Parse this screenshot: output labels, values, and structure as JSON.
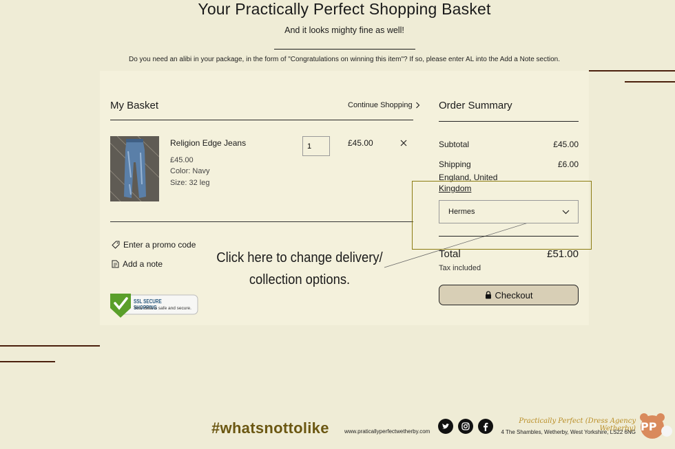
{
  "header": {
    "title": "Your Practically Perfect Shopping Basket",
    "subtitle": "And it looks mighty fine as well!",
    "note": "Do you need an alibi in your package, in the form of \"Congratulations on winning this item\"? If so, please enter AL into the Add a Note section."
  },
  "basket": {
    "heading": "My Basket",
    "continue_label": "Continue Shopping",
    "item": {
      "name": "Religion Edge Jeans",
      "price": "£45.00",
      "color": "Color: Navy",
      "size": "Size: 32 leg",
      "quantity": "1",
      "line_total": "£45.00"
    },
    "promo_label": "Enter a promo code",
    "note_label": "Add a note"
  },
  "ssl_badge": {
    "line1": "SSL SECURE SHOPPING",
    "line2": "Your data is safe and secure."
  },
  "annotation": {
    "line1": "Click here to change delivery/",
    "line2": "collection options."
  },
  "summary": {
    "heading": "Order Summary",
    "subtotal_label": "Subtotal",
    "subtotal_value": "£45.00",
    "shipping_label": "Shipping",
    "shipping_value": "£6.00",
    "shipping_region": "England, United Kingdom",
    "delivery_option": "Hermes",
    "total_label": "Total",
    "total_value": "£51.00",
    "tax_note": "Tax included",
    "checkout_label": "Checkout"
  },
  "footer": {
    "hashtag": "#whatsnottolike",
    "url": "www.praticallyperfectwetherby.com",
    "brand": "Practically Perfect (Dress Agency Wetherby)",
    "address": "4 The Shambles, Wetherby, West Yorkshire, LS22 6NG",
    "logo_text": "PP"
  },
  "icons": {
    "continue": "chevron-right-icon",
    "remove": "close-icon",
    "promo": "tag-icon",
    "note": "note-icon",
    "select": "chevron-down-icon",
    "checkout": "lock-icon",
    "social": [
      "twitter-icon",
      "instagram-icon",
      "facebook-icon"
    ]
  },
  "colors": {
    "background": "#efecd6",
    "panel": "#f4f1dc",
    "accent_brown": "#4a1f0c",
    "hashtag": "#6b5712",
    "checkout_button": "#d8cfb6",
    "highlight_border": "#8a7a10"
  }
}
